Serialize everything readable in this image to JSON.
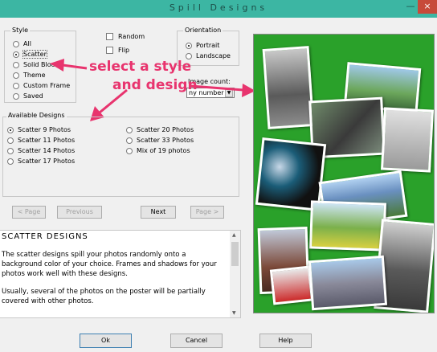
{
  "window": {
    "title": "Spill Designs",
    "minimize": "—",
    "close": "×"
  },
  "style_group": {
    "label": "Style",
    "options": [
      {
        "label": "All",
        "selected": false
      },
      {
        "label": "Scatter",
        "selected": true
      },
      {
        "label": "Solid Block",
        "selected": false
      },
      {
        "label": "Theme",
        "selected": false
      },
      {
        "label": "Custom Frame",
        "selected": false
      },
      {
        "label": "Saved",
        "selected": false
      }
    ]
  },
  "checks": {
    "random": "Random",
    "flip": "Flip"
  },
  "orientation": {
    "label": "Orientation",
    "portrait": "Portrait",
    "landscape": "Landscape"
  },
  "image_count": {
    "label": "Image count:",
    "value": "ny number"
  },
  "annotation": {
    "line1": "select a style",
    "line2": "and design"
  },
  "designs": {
    "label": "Available Designs",
    "left": [
      "Scatter 9 Photos",
      "Scatter 11 Photos",
      "Scatter 14 Photos",
      "Scatter 17 Photos"
    ],
    "right": [
      "Scatter 20 Photos",
      "Scatter 33 Photos",
      "Mix of 19 photos"
    ]
  },
  "nav": {
    "prev_page": "< Page",
    "previous": "Previous",
    "next": "Next",
    "next_page": "Page >"
  },
  "description": {
    "heading": "SCATTER DESIGNS",
    "p1": "The scatter designs spill your photos randomly onto a background color of your choice.  Frames and shadows for your photos work well with these designs.",
    "p2": "Usually, several of the photos on the poster will be partially covered with other photos."
  },
  "footer": {
    "ok": "Ok",
    "cancel": "Cancel",
    "help": "Help"
  },
  "colors": {
    "titlebar": "#3cb6a3",
    "preview_bg": "#2aa12a",
    "annotation": "#e8346e"
  }
}
